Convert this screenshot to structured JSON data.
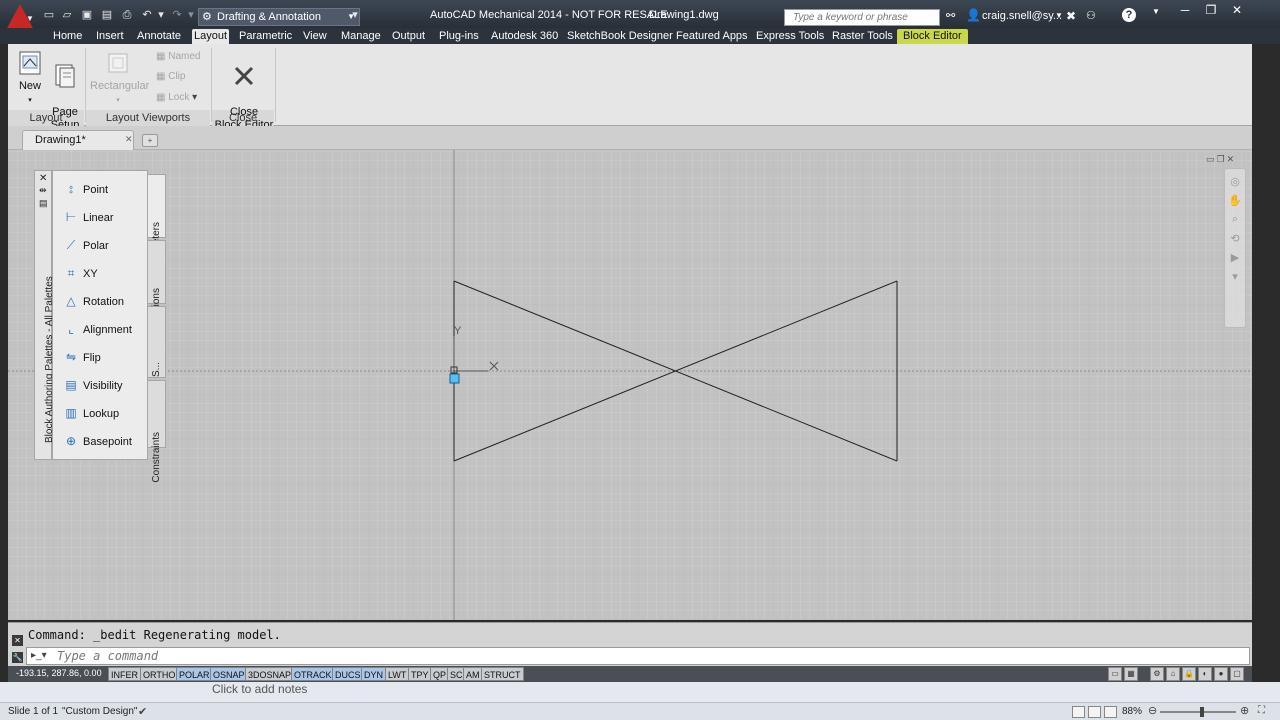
{
  "titlebar": {
    "workspace": "Drafting & Annotation",
    "app_title": "AutoCAD Mechanical 2014 - NOT FOR RESALE",
    "doc_title": "Drawing1.dwg",
    "search_placeholder": "Type a keyword or phrase",
    "user": "craig.snell@sy...",
    "help": "?"
  },
  "ribbon_tabs": [
    "Home",
    "Insert",
    "Annotate",
    "Layout",
    "Parametric",
    "View",
    "Manage",
    "Output",
    "Plug-ins",
    "Autodesk 360",
    "SketchBook Designer",
    "Featured Apps",
    "Express Tools",
    "Raster Tools",
    "Block Editor"
  ],
  "active_tab": "Layout",
  "ribbon": {
    "layout_panel": {
      "title": "Layout",
      "new_label": "New",
      "page_setup_label": "Page\nSetup"
    },
    "viewports_panel": {
      "title": "Layout Viewports",
      "rectangular": "Rectangular",
      "named": "Named",
      "clip": "Clip",
      "lock": "Lock"
    },
    "close_panel": {
      "title": "Close",
      "close_label": "Close\nBlock Editor"
    }
  },
  "document_tab": "Drawing1*",
  "palette": {
    "title": "Block Authoring Palettes - All Palettes",
    "items": [
      "Point",
      "Linear",
      "Polar",
      "XY",
      "Rotation",
      "Alignment",
      "Flip",
      "Visibility",
      "Lookup",
      "Basepoint"
    ],
    "tabs": [
      "Parameters",
      "Actions",
      "Parameter S...",
      "Constraints"
    ]
  },
  "ucs": {
    "y_label": "Y"
  },
  "command_line": {
    "history": "Command: _bedit Regenerating model.",
    "placeholder": "Type a command"
  },
  "status_bar": {
    "coords": "-193.15, 287.86, 0.00",
    "toggles": [
      "INFER",
      "ORTHO",
      "POLAR",
      "OSNAP",
      "3DOSNAP",
      "OTRACK",
      "DUCS",
      "DYN",
      "LWT",
      "TPY",
      "QP",
      "SC",
      "AM",
      "STRUCT"
    ],
    "on": [
      "POLAR",
      "OSNAP",
      "OTRACK",
      "DUCS",
      "DYN"
    ]
  },
  "powerpoint": {
    "notes": "Click to add notes",
    "slide": "Slide 1 of 1",
    "theme": "\"Custom Design\"",
    "zoom": "88%"
  },
  "colors": {
    "block_editor_tab": "#c9d84a",
    "canvas": "#c2c2c2",
    "grip": "#4fc3f7",
    "logo": "#c62828"
  }
}
